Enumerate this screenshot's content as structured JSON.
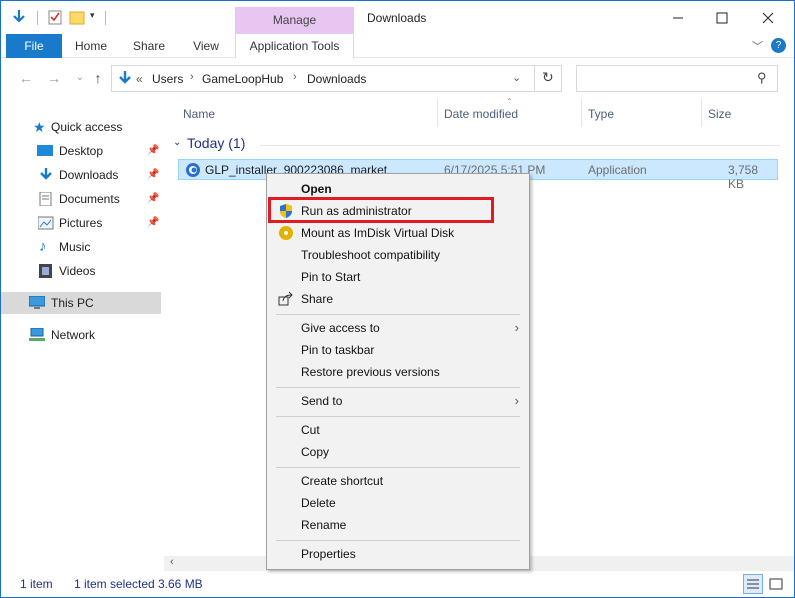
{
  "window": {
    "title": "Downloads",
    "contextual_tab": "Manage"
  },
  "ribbon": {
    "file": "File",
    "home": "Home",
    "share": "Share",
    "view": "View",
    "app_tools": "Application Tools"
  },
  "address": {
    "segments": [
      "Users",
      "GameLoopHub",
      "Downloads"
    ]
  },
  "nav_pane": {
    "quick_access": "Quick access",
    "items": [
      "Desktop",
      "Downloads",
      "Documents",
      "Pictures",
      "Music",
      "Videos"
    ],
    "this_pc": "This PC",
    "network": "Network"
  },
  "columns": {
    "name": "Name",
    "date": "Date modified",
    "type": "Type",
    "size": "Size"
  },
  "group": "Today (1)",
  "file": {
    "name": "GLP_installer_900223086_market",
    "date": "6/17/2025 5:51 PM",
    "type": "Application",
    "size": "3,758 KB"
  },
  "context_menu": {
    "open": "Open",
    "run_admin": "Run as administrator",
    "mount": "Mount as ImDisk Virtual Disk",
    "troubleshoot": "Troubleshoot compatibility",
    "pin_start": "Pin to Start",
    "share": "Share",
    "give_access": "Give access to",
    "pin_taskbar": "Pin to taskbar",
    "restore": "Restore previous versions",
    "send_to": "Send to",
    "cut": "Cut",
    "copy": "Copy",
    "create_shortcut": "Create shortcut",
    "delete": "Delete",
    "rename": "Rename",
    "properties": "Properties"
  },
  "status": {
    "count": "1 item",
    "selected": "1 item selected",
    "size": "3.66 MB"
  },
  "colors": {
    "accent": "#1979ca",
    "highlight_box": "#e01b24",
    "selection": "#cce8ff",
    "manage_tab": "#e7c6f1"
  }
}
